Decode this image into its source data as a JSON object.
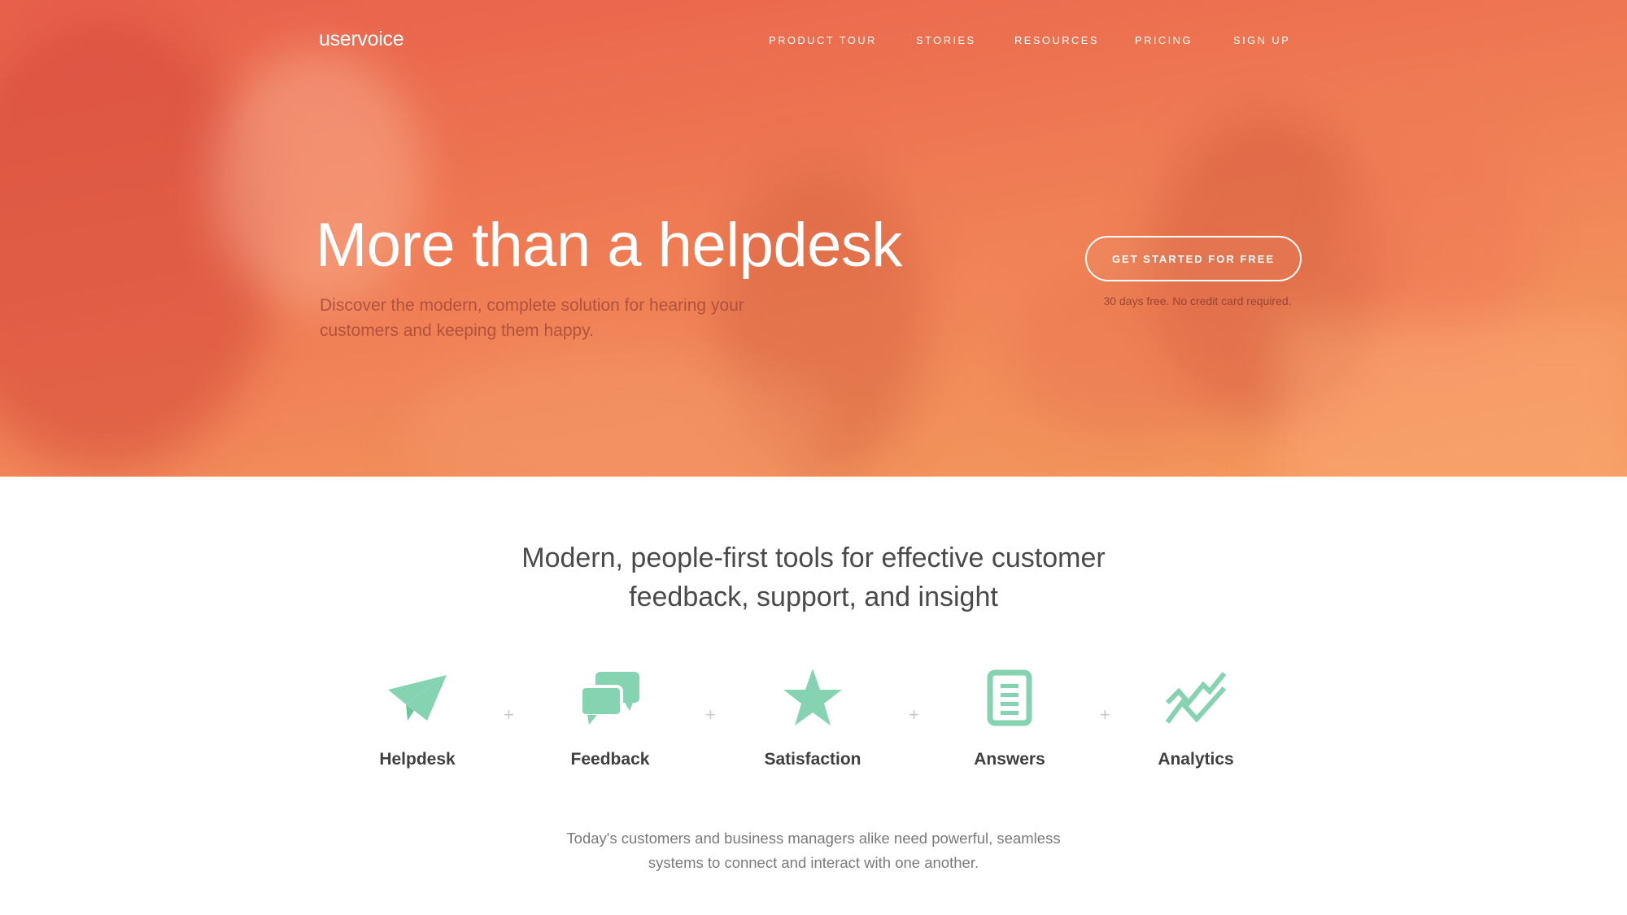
{
  "brand": {
    "logo_text": "uservoice"
  },
  "nav": {
    "items": [
      {
        "label": "PRODUCT TOUR"
      },
      {
        "label": "STORIES"
      },
      {
        "label": "RESOURCES"
      },
      {
        "label": "PRICING"
      },
      {
        "label": "SIGN UP"
      }
    ]
  },
  "hero": {
    "title": "More than a helpdesk",
    "subtitle_line1": "Discover the modern, complete solution for hearing your",
    "subtitle_line2": "customers and keeping them happy.",
    "cta_label": "GET STARTED FOR FREE",
    "cta_note": "30 days free. No credit card required."
  },
  "features": {
    "title_line1": "Modern, people-first tools for effective customer",
    "title_line2": "feedback, support, and insight",
    "separator": "+",
    "items": [
      {
        "label": "Helpdesk",
        "icon": "paper-plane-icon"
      },
      {
        "label": "Feedback",
        "icon": "chat-bubbles-icon"
      },
      {
        "label": "Satisfaction",
        "icon": "star-icon"
      },
      {
        "label": "Answers",
        "icon": "document-icon"
      },
      {
        "label": "Analytics",
        "icon": "line-chart-icon"
      }
    ],
    "description_line1": "Today's customers and business managers alike need powerful, seamless",
    "description_line2": "systems to connect and interact with one another."
  },
  "colors": {
    "hero_start": "#e8604b",
    "hero_end": "#f39a5e",
    "icon_accent": "#86d3b2",
    "heading_text": "#4a4a4a",
    "body_text": "#7a7a7a"
  }
}
